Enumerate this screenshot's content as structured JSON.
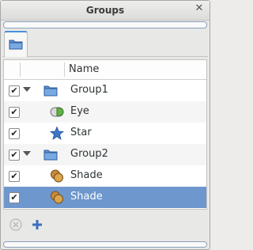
{
  "window": {
    "title": "Groups"
  },
  "tree": {
    "header": {
      "name": "Name"
    },
    "rows": [
      {
        "label": "Group1",
        "checked": true,
        "icon": "folder-icon",
        "level": 0,
        "expanded": true
      },
      {
        "label": "Eye",
        "checked": true,
        "icon": "eye-toggle-icon",
        "level": 1
      },
      {
        "label": "Star",
        "checked": true,
        "icon": "star-icon",
        "level": 1
      },
      {
        "label": "Group2",
        "checked": true,
        "icon": "folder-icon",
        "level": 0,
        "expanded": true
      },
      {
        "label": "Shade",
        "checked": true,
        "icon": "shade-icon",
        "level": 1
      },
      {
        "label": "Shade",
        "checked": true,
        "icon": "shade-icon",
        "level": 1,
        "selected": true
      }
    ]
  },
  "colors": {
    "selection": "#6e97cd",
    "folder": "#5b8fd0",
    "star": "#3e78c7",
    "accent_bar": "#8ca2ba"
  }
}
